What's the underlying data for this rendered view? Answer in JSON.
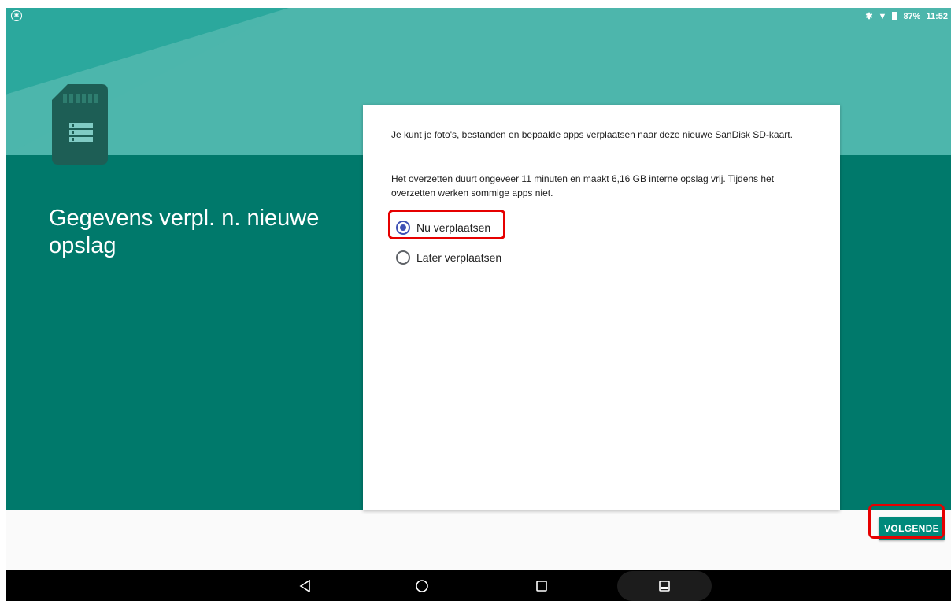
{
  "status_bar": {
    "left_icon": "bluetooth-circle-icon",
    "battery_text": "87%",
    "time": "11:52"
  },
  "hero": {
    "title": "Gegevens verpl. n. nieuwe opslag",
    "icon": "sd-card-icon"
  },
  "card": {
    "description_1": "Je kunt je foto's, bestanden en bepaalde apps verplaatsen naar deze nieuwe SanDisk SD-kaart.",
    "description_2": "Het overzetten duurt ongeveer 11 minuten en maakt 6,16 GB interne opslag vrij. Tijdens het overzetten werken sommige apps niet.",
    "options": [
      {
        "label": "Nu verplaatsen",
        "checked": true
      },
      {
        "label": "Later verplaatsen",
        "checked": false
      }
    ]
  },
  "footer": {
    "next_label": "VOLGENDE"
  },
  "nav": {
    "back": "back-icon",
    "home": "home-icon",
    "recents": "recents-icon",
    "screenshot": "screenshot-icon"
  },
  "colors": {
    "teal_dark": "#00796b",
    "teal_light": "#4db6ac",
    "accent": "#00897b",
    "radio_checked": "#3f51b5",
    "highlight": "#e60000"
  }
}
